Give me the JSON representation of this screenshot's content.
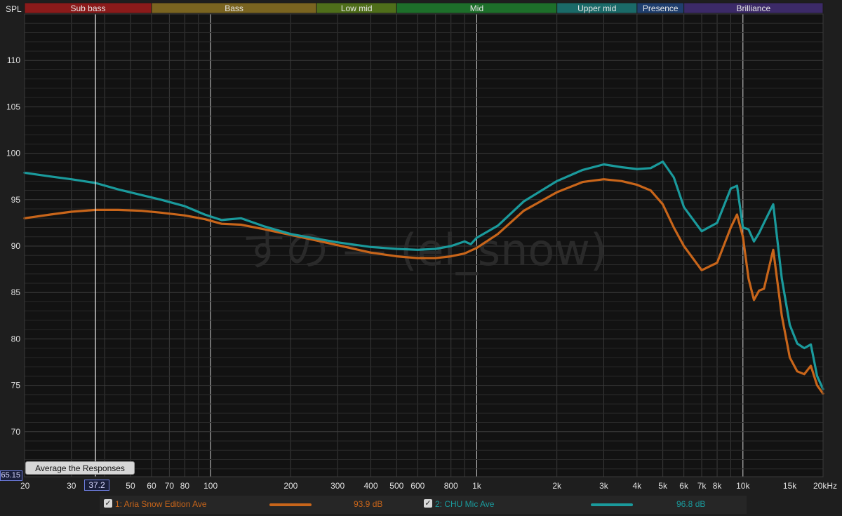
{
  "chart_data": {
    "type": "line",
    "ylabel": "SPL",
    "xlabel_unit": "kHz",
    "x_scale": "log",
    "xlim": [
      20,
      20000
    ],
    "ylim": [
      65.15,
      115
    ],
    "grid": true,
    "bands": [
      {
        "name": "Sub bass",
        "from": 20,
        "to": 60,
        "color": "#8b1a1a"
      },
      {
        "name": "Bass",
        "from": 60,
        "to": 250,
        "color": "#7a6420"
      },
      {
        "name": "Low mid",
        "from": 250,
        "to": 500,
        "color": "#4f6e1a"
      },
      {
        "name": "Mid",
        "from": 500,
        "to": 2000,
        "color": "#1d6f2a"
      },
      {
        "name": "Upper mid",
        "from": 2000,
        "to": 4000,
        "color": "#1a6a68"
      },
      {
        "name": "Presence",
        "from": 4000,
        "to": 6000,
        "color": "#203f6e"
      },
      {
        "name": "Brilliance",
        "from": 6000,
        "to": 20000,
        "color": "#3c2a68"
      }
    ],
    "x_ticks": [
      {
        "value": 20,
        "label": "20"
      },
      {
        "value": 30,
        "label": "30"
      },
      {
        "value": 50,
        "label": "50"
      },
      {
        "value": 60,
        "label": "60"
      },
      {
        "value": 70,
        "label": "70"
      },
      {
        "value": 80,
        "label": "80"
      },
      {
        "value": 100,
        "label": "100"
      },
      {
        "value": 200,
        "label": "200"
      },
      {
        "value": 300,
        "label": "300"
      },
      {
        "value": 400,
        "label": "400"
      },
      {
        "value": 500,
        "label": "500"
      },
      {
        "value": 600,
        "label": "600"
      },
      {
        "value": 800,
        "label": "800"
      },
      {
        "value": 1000,
        "label": "1k"
      },
      {
        "value": 2000,
        "label": "2k"
      },
      {
        "value": 3000,
        "label": "3k"
      },
      {
        "value": 4000,
        "label": "4k"
      },
      {
        "value": 5000,
        "label": "5k"
      },
      {
        "value": 6000,
        "label": "6k"
      },
      {
        "value": 7000,
        "label": "7k"
      },
      {
        "value": 8000,
        "label": "8k"
      },
      {
        "value": 10000,
        "label": "10k"
      },
      {
        "value": 15000,
        "label": "15k"
      },
      {
        "value": 20000,
        "label": "20kHz"
      }
    ],
    "y_ticks": [
      70,
      75,
      80,
      85,
      90,
      95,
      100,
      105,
      110
    ],
    "series": [
      {
        "name": "1: Aria Snow Edition Ave",
        "color": "#c8651a",
        "level": "93.9 dB",
        "x": [
          20,
          25,
          30,
          37,
          45,
          55,
          65,
          80,
          95,
          110,
          130,
          160,
          200,
          250,
          300,
          400,
          500,
          600,
          700,
          800,
          900,
          1000,
          1200,
          1500,
          2000,
          2500,
          3000,
          3500,
          4000,
          4500,
          5000,
          5500,
          6000,
          7000,
          8000,
          9000,
          9500,
          10000,
          10500,
          11000,
          11500,
          12000,
          13000,
          14000,
          15000,
          16000,
          17000,
          18000,
          19000,
          20000
        ],
        "y": [
          93.0,
          93.4,
          93.7,
          93.9,
          93.9,
          93.8,
          93.6,
          93.3,
          92.9,
          92.4,
          92.3,
          91.8,
          91.2,
          90.6,
          90.1,
          89.3,
          88.9,
          88.7,
          88.7,
          88.9,
          89.2,
          89.8,
          91.3,
          93.8,
          95.8,
          96.9,
          97.2,
          97.0,
          96.6,
          96.0,
          94.5,
          92.0,
          90.0,
          87.4,
          88.2,
          92.0,
          93.4,
          91.0,
          86.5,
          84.2,
          85.2,
          85.4,
          89.6,
          82.5,
          78.0,
          76.5,
          76.2,
          77.1,
          75.0,
          74.1
        ]
      },
      {
        "name": "2: CHU Mic Ave",
        "color": "#1a9a9c",
        "level": "96.8 dB",
        "x": [
          20,
          25,
          30,
          37,
          45,
          55,
          65,
          80,
          95,
          110,
          130,
          160,
          200,
          250,
          300,
          400,
          500,
          600,
          700,
          800,
          900,
          950,
          1000,
          1200,
          1500,
          2000,
          2500,
          3000,
          3500,
          4000,
          4500,
          5000,
          5500,
          6000,
          7000,
          8000,
          9000,
          9500,
          10000,
          10500,
          11000,
          11500,
          12000,
          13000,
          14000,
          15000,
          16000,
          17000,
          18000,
          19000,
          20000
        ],
        "y": [
          97.9,
          97.5,
          97.2,
          96.8,
          96.1,
          95.5,
          95.0,
          94.3,
          93.4,
          92.8,
          93.0,
          92.1,
          91.3,
          90.8,
          90.4,
          89.9,
          89.7,
          89.6,
          89.7,
          90.0,
          90.5,
          90.2,
          90.9,
          92.2,
          94.8,
          97.0,
          98.2,
          98.8,
          98.5,
          98.3,
          98.4,
          99.1,
          97.4,
          94.2,
          91.6,
          92.5,
          96.2,
          96.5,
          92.0,
          91.8,
          90.5,
          91.4,
          92.5,
          94.5,
          86.5,
          81.5,
          79.5,
          79.0,
          79.4,
          76.0,
          74.6
        ]
      }
    ]
  },
  "watermark": "すの — (el_snow)",
  "average_button_label": "Average the Responses",
  "cursor": {
    "x_readout": "37.2",
    "y_readout": "65.15"
  }
}
